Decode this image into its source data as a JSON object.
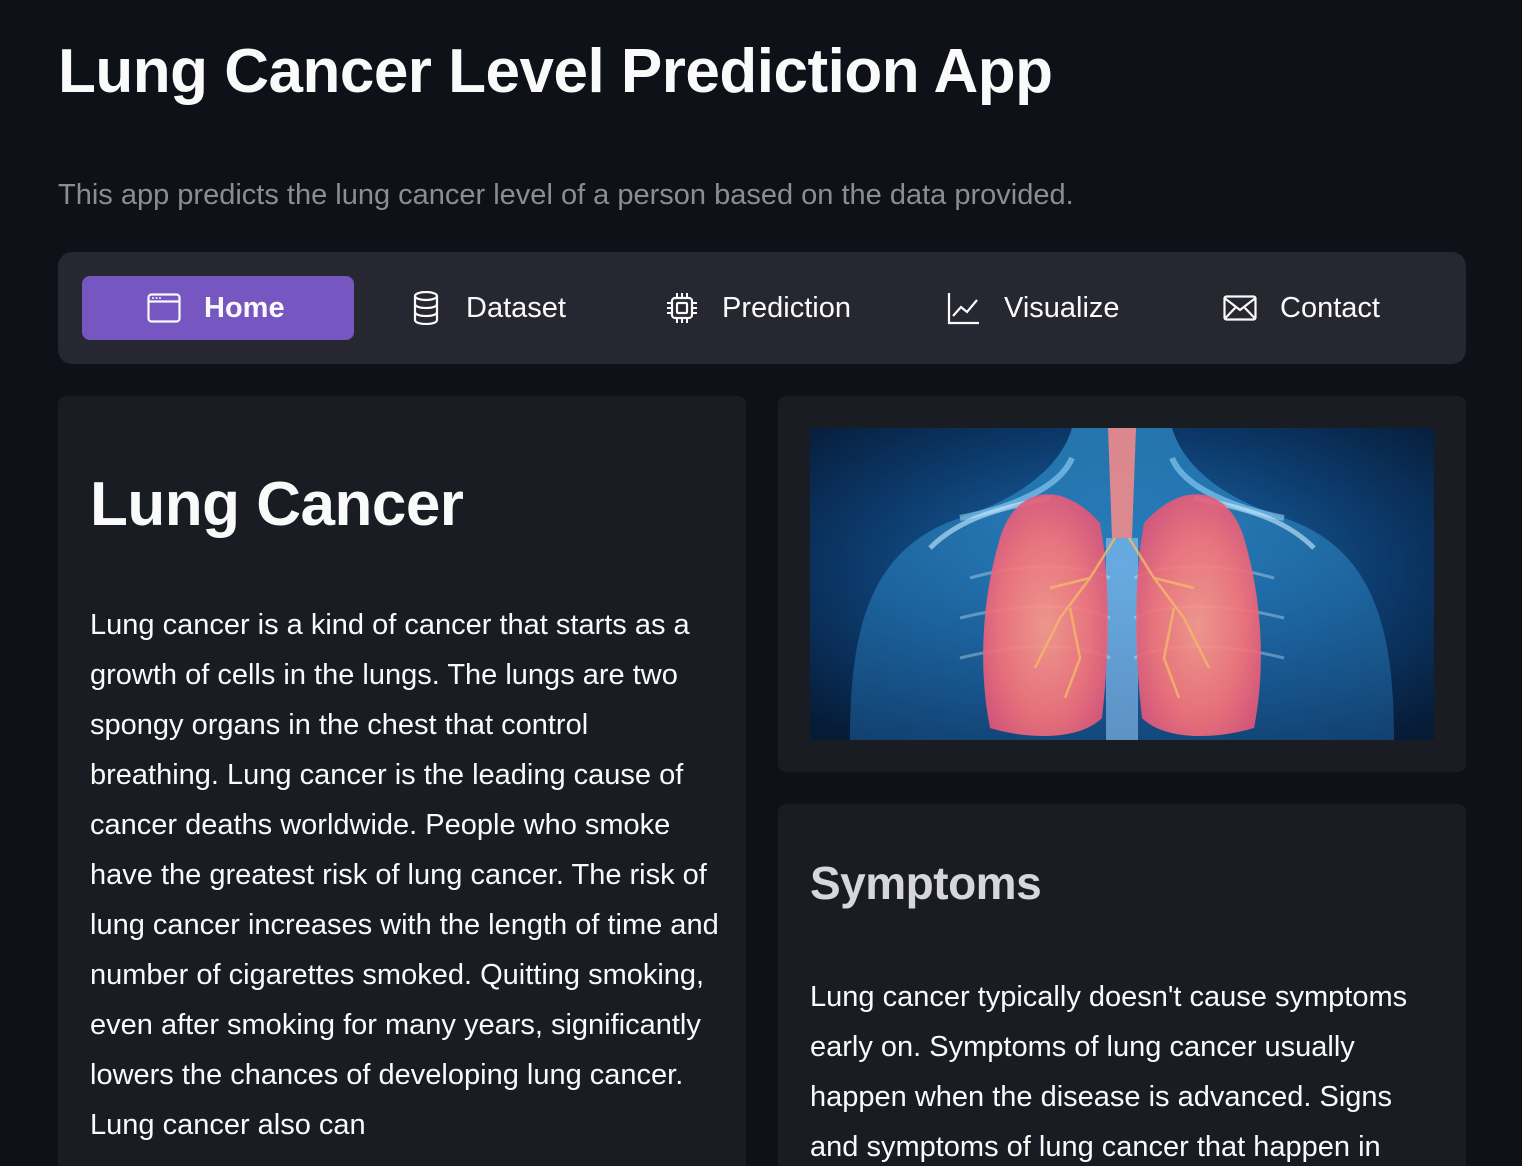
{
  "app": {
    "title": "Lung Cancer Level Prediction App",
    "subtitle": "This app predicts the lung cancer level of a person based on the data provided."
  },
  "nav": {
    "active": "Home",
    "items": [
      {
        "label": "Home",
        "icon": "window-icon"
      },
      {
        "label": "Dataset",
        "icon": "database-icon"
      },
      {
        "label": "Prediction",
        "icon": "cpu-icon"
      },
      {
        "label": "Visualize",
        "icon": "line-chart-icon"
      },
      {
        "label": "Contact",
        "icon": "envelope-icon"
      }
    ]
  },
  "colors": {
    "background": "#0e1117",
    "card": "#1a1c24",
    "nav_bar": "#262730",
    "accent": "#7656c0",
    "subtitle": "#8b8d93"
  },
  "lung_cancer": {
    "heading": "Lung Cancer",
    "body": "Lung cancer is a kind of cancer that starts as a growth of cells in the lungs. The lungs are two spongy organs in the chest that control breathing. Lung cancer is the leading cause of cancer deaths worldwide. People who smoke have the greatest risk of lung cancer. The risk of lung cancer increases with the length of time and number of cigarettes smoked. Quitting smoking, even after smoking for many years, significantly lowers the chances of developing lung cancer. Lung cancer also can"
  },
  "image": {
    "subject": "lungs-illustration"
  },
  "symptoms": {
    "heading": "Symptoms",
    "body": "Lung cancer typically doesn't cause symptoms early on. Symptoms of lung cancer usually happen when the disease is advanced. Signs and symptoms of lung cancer that happen in"
  }
}
